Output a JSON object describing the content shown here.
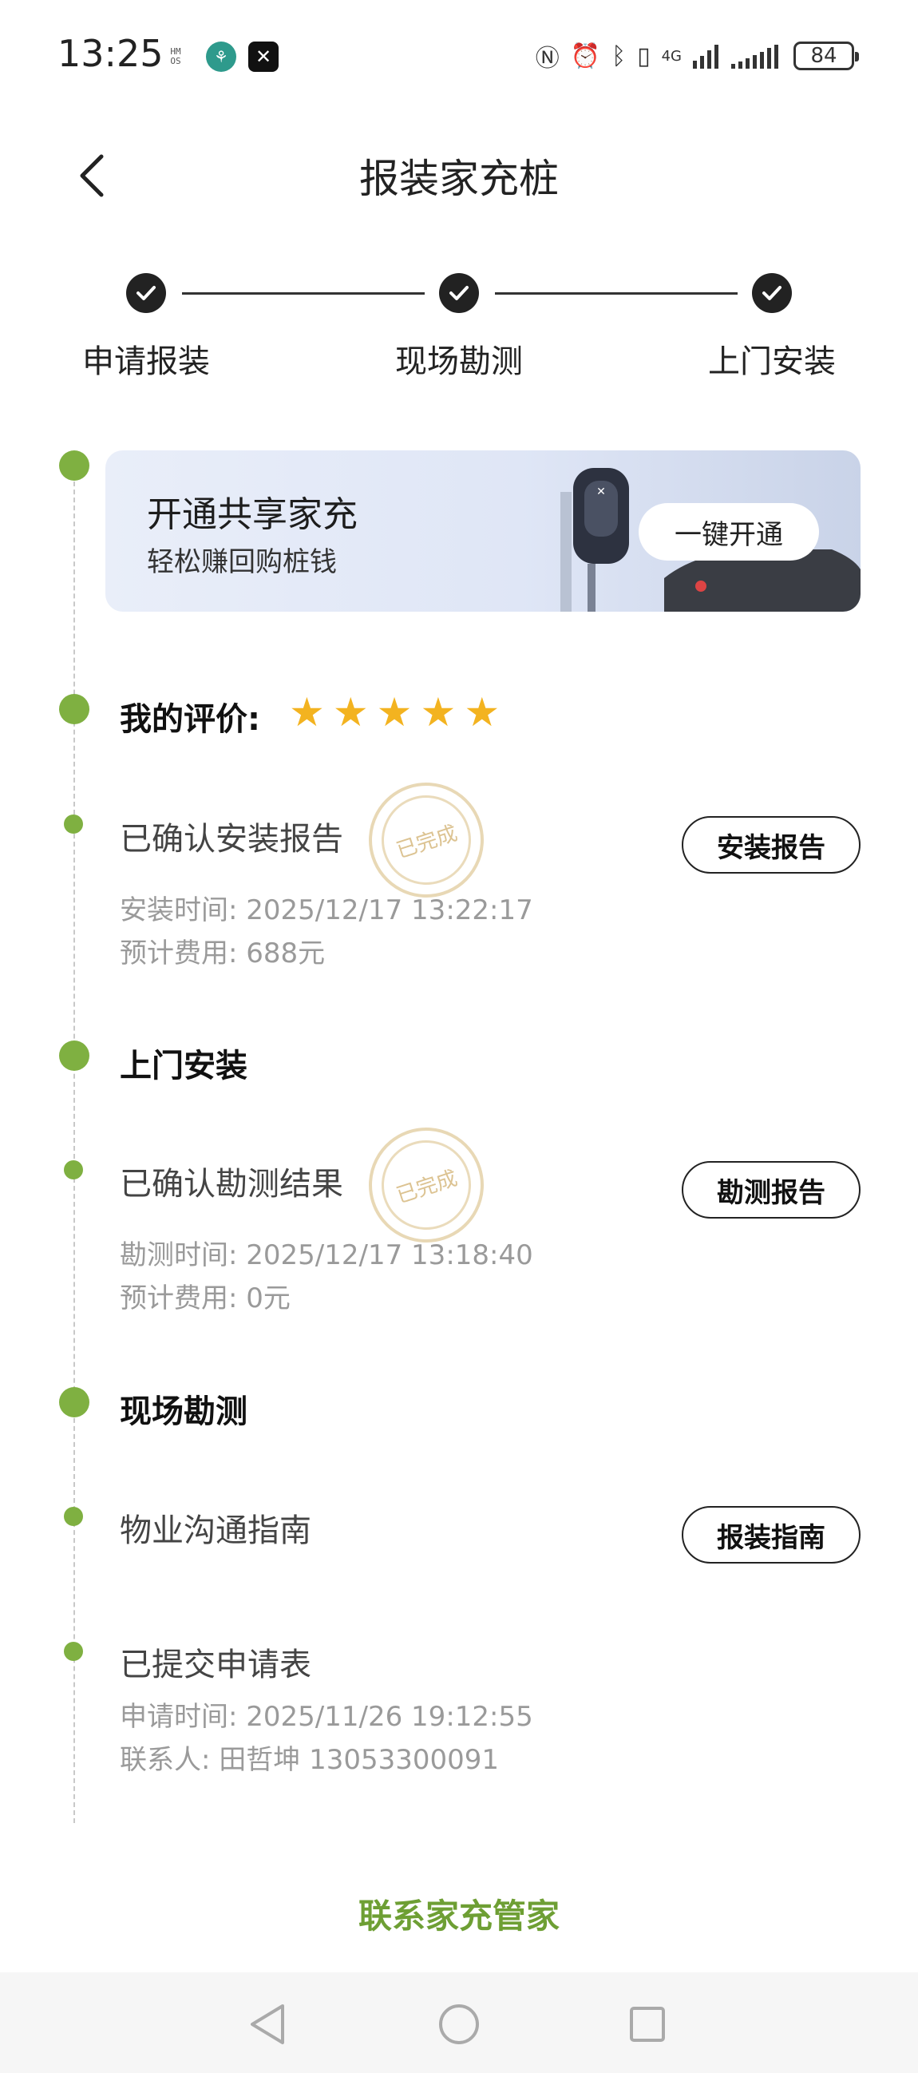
{
  "status_bar": {
    "time": "13:25",
    "hm_badge": "H M\nO S",
    "battery": "84",
    "network": "4G",
    "icons": [
      "nfc-icon",
      "alarm-icon",
      "bluetooth-icon",
      "vibrate-icon",
      "signal-icon",
      "signal-icon",
      "battery-icon"
    ]
  },
  "header": {
    "title": "报装家充桩"
  },
  "stepper": {
    "steps": [
      {
        "label": "申请报装",
        "done": true
      },
      {
        "label": "现场勘测",
        "done": true
      },
      {
        "label": "上门安装",
        "done": true
      }
    ]
  },
  "banner": {
    "title": "开通共享家充",
    "subtitle": "轻松赚回购桩钱",
    "button": "一键开通"
  },
  "rating": {
    "label": "我的评价:",
    "stars": 5
  },
  "timeline": {
    "install_confirmed": {
      "title": "已确认安装报告",
      "stamp": "已完成",
      "time_label": "安装时间:",
      "time_value": "2025/12/17 13:22:17",
      "fee_label": "预计费用:",
      "fee_value": "688元",
      "button": "安装报告"
    },
    "section_install": "上门安装",
    "survey_confirmed": {
      "title": "已确认勘测结果",
      "stamp": "已完成",
      "time_label": "勘测时间:",
      "time_value": "2025/12/17 13:18:40",
      "fee_label": "预计费用:",
      "fee_value": "0元",
      "button": "勘测报告"
    },
    "section_survey": "现场勘测",
    "guide": {
      "title": "物业沟通指南",
      "button": "报装指南"
    },
    "application": {
      "title": "已提交申请表",
      "time_label": "申请时间:",
      "time_value": "2025/11/26 19:12:55",
      "contact_label": "联系人:",
      "contact_value": "田哲坤 13053300091"
    }
  },
  "footer": {
    "contact": "联系家充管家"
  },
  "colors": {
    "accent_green": "#7fb041",
    "link_green": "#6e9f34",
    "star": "#f3b320",
    "stamp": "#d6b878"
  }
}
